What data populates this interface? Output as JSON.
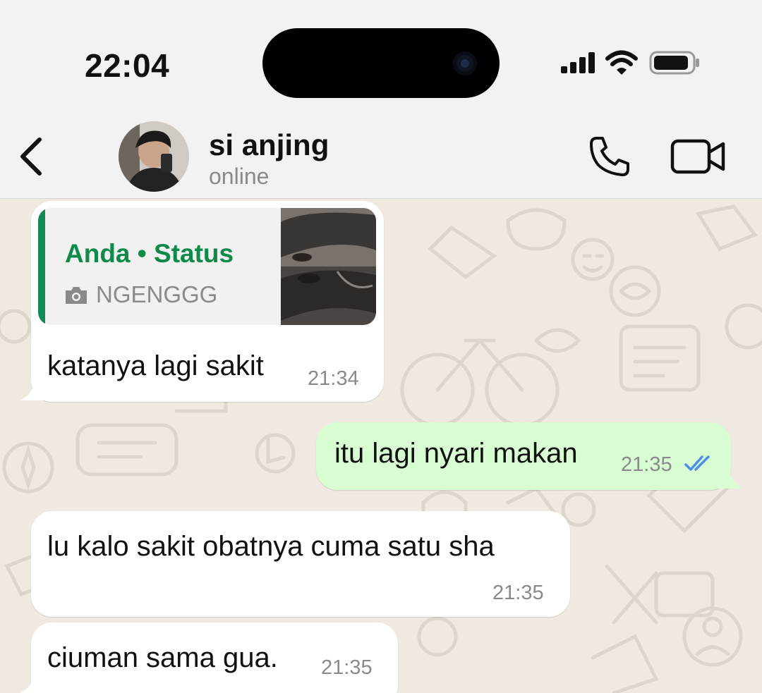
{
  "status_bar": {
    "time": "22:04",
    "icons": [
      "cellular-signal-icon",
      "wifi-icon",
      "battery-icon"
    ]
  },
  "header": {
    "back_icon": "chevron-left-icon",
    "contact_name": "si anjing",
    "contact_status": "online",
    "actions": [
      "phone-icon",
      "video-camera-icon"
    ]
  },
  "colors": {
    "incoming_bubble": "#ffffff",
    "outgoing_bubble": "#d9fdd3",
    "quote_accent": "#128a55",
    "quote_title": "#0f8a4b",
    "read_ticks": "#4f8fe6",
    "chat_background": "#efe9e1"
  },
  "messages": [
    {
      "direction": "incoming",
      "reply_to": {
        "title": "Anda • Status",
        "caption": "NGENGGG",
        "icon": "camera-icon"
      },
      "text": "katanya lagi sakit",
      "time": "21:34"
    },
    {
      "direction": "outgoing",
      "text": "itu lagi nyari makan",
      "time": "21:35",
      "status_icon": "double-check-read-icon"
    },
    {
      "direction": "incoming",
      "text": "lu kalo sakit obatnya cuma satu sha",
      "time": "21:35"
    },
    {
      "direction": "incoming",
      "text": "ciuman sama gua.",
      "time": "21:35"
    }
  ]
}
